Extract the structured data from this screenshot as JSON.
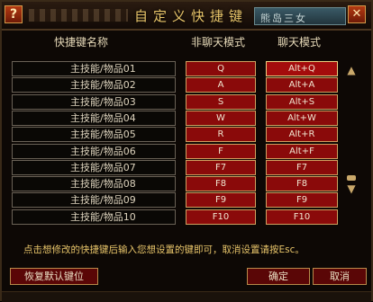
{
  "title": "自定义快捷键",
  "title_deco_text": "熊岛三女",
  "help_label": "?",
  "close_label": "✕",
  "headers": {
    "name": "快捷键名称",
    "normal": "非聊天模式",
    "chat": "聊天模式"
  },
  "rows": [
    {
      "name": "主技能/物品01",
      "normal": "Q",
      "chat": "Alt+Q"
    },
    {
      "name": "主技能/物品02",
      "normal": "A",
      "chat": "Alt+A"
    },
    {
      "name": "主技能/物品03",
      "normal": "S",
      "chat": "Alt+S"
    },
    {
      "name": "主技能/物品04",
      "normal": "W",
      "chat": "Alt+W"
    },
    {
      "name": "主技能/物品05",
      "normal": "R",
      "chat": "Alt+R"
    },
    {
      "name": "主技能/物品06",
      "normal": "F",
      "chat": "Alt+F"
    },
    {
      "name": "主技能/物品07",
      "normal": "F7",
      "chat": "F7"
    },
    {
      "name": "主技能/物品08",
      "normal": "F8",
      "chat": "F8"
    },
    {
      "name": "主技能/物品09",
      "normal": "F9",
      "chat": "F9"
    },
    {
      "name": "主技能/物品10",
      "normal": "F10",
      "chat": "F10"
    }
  ],
  "hint": "点击想修改的快捷键后输入您想设置的键即可，取消设置请按Esc。",
  "buttons": {
    "reset": "恢复默认键位",
    "ok": "确定",
    "cancel": "取消"
  },
  "scroll": {
    "up": "▲",
    "down": "▼"
  }
}
